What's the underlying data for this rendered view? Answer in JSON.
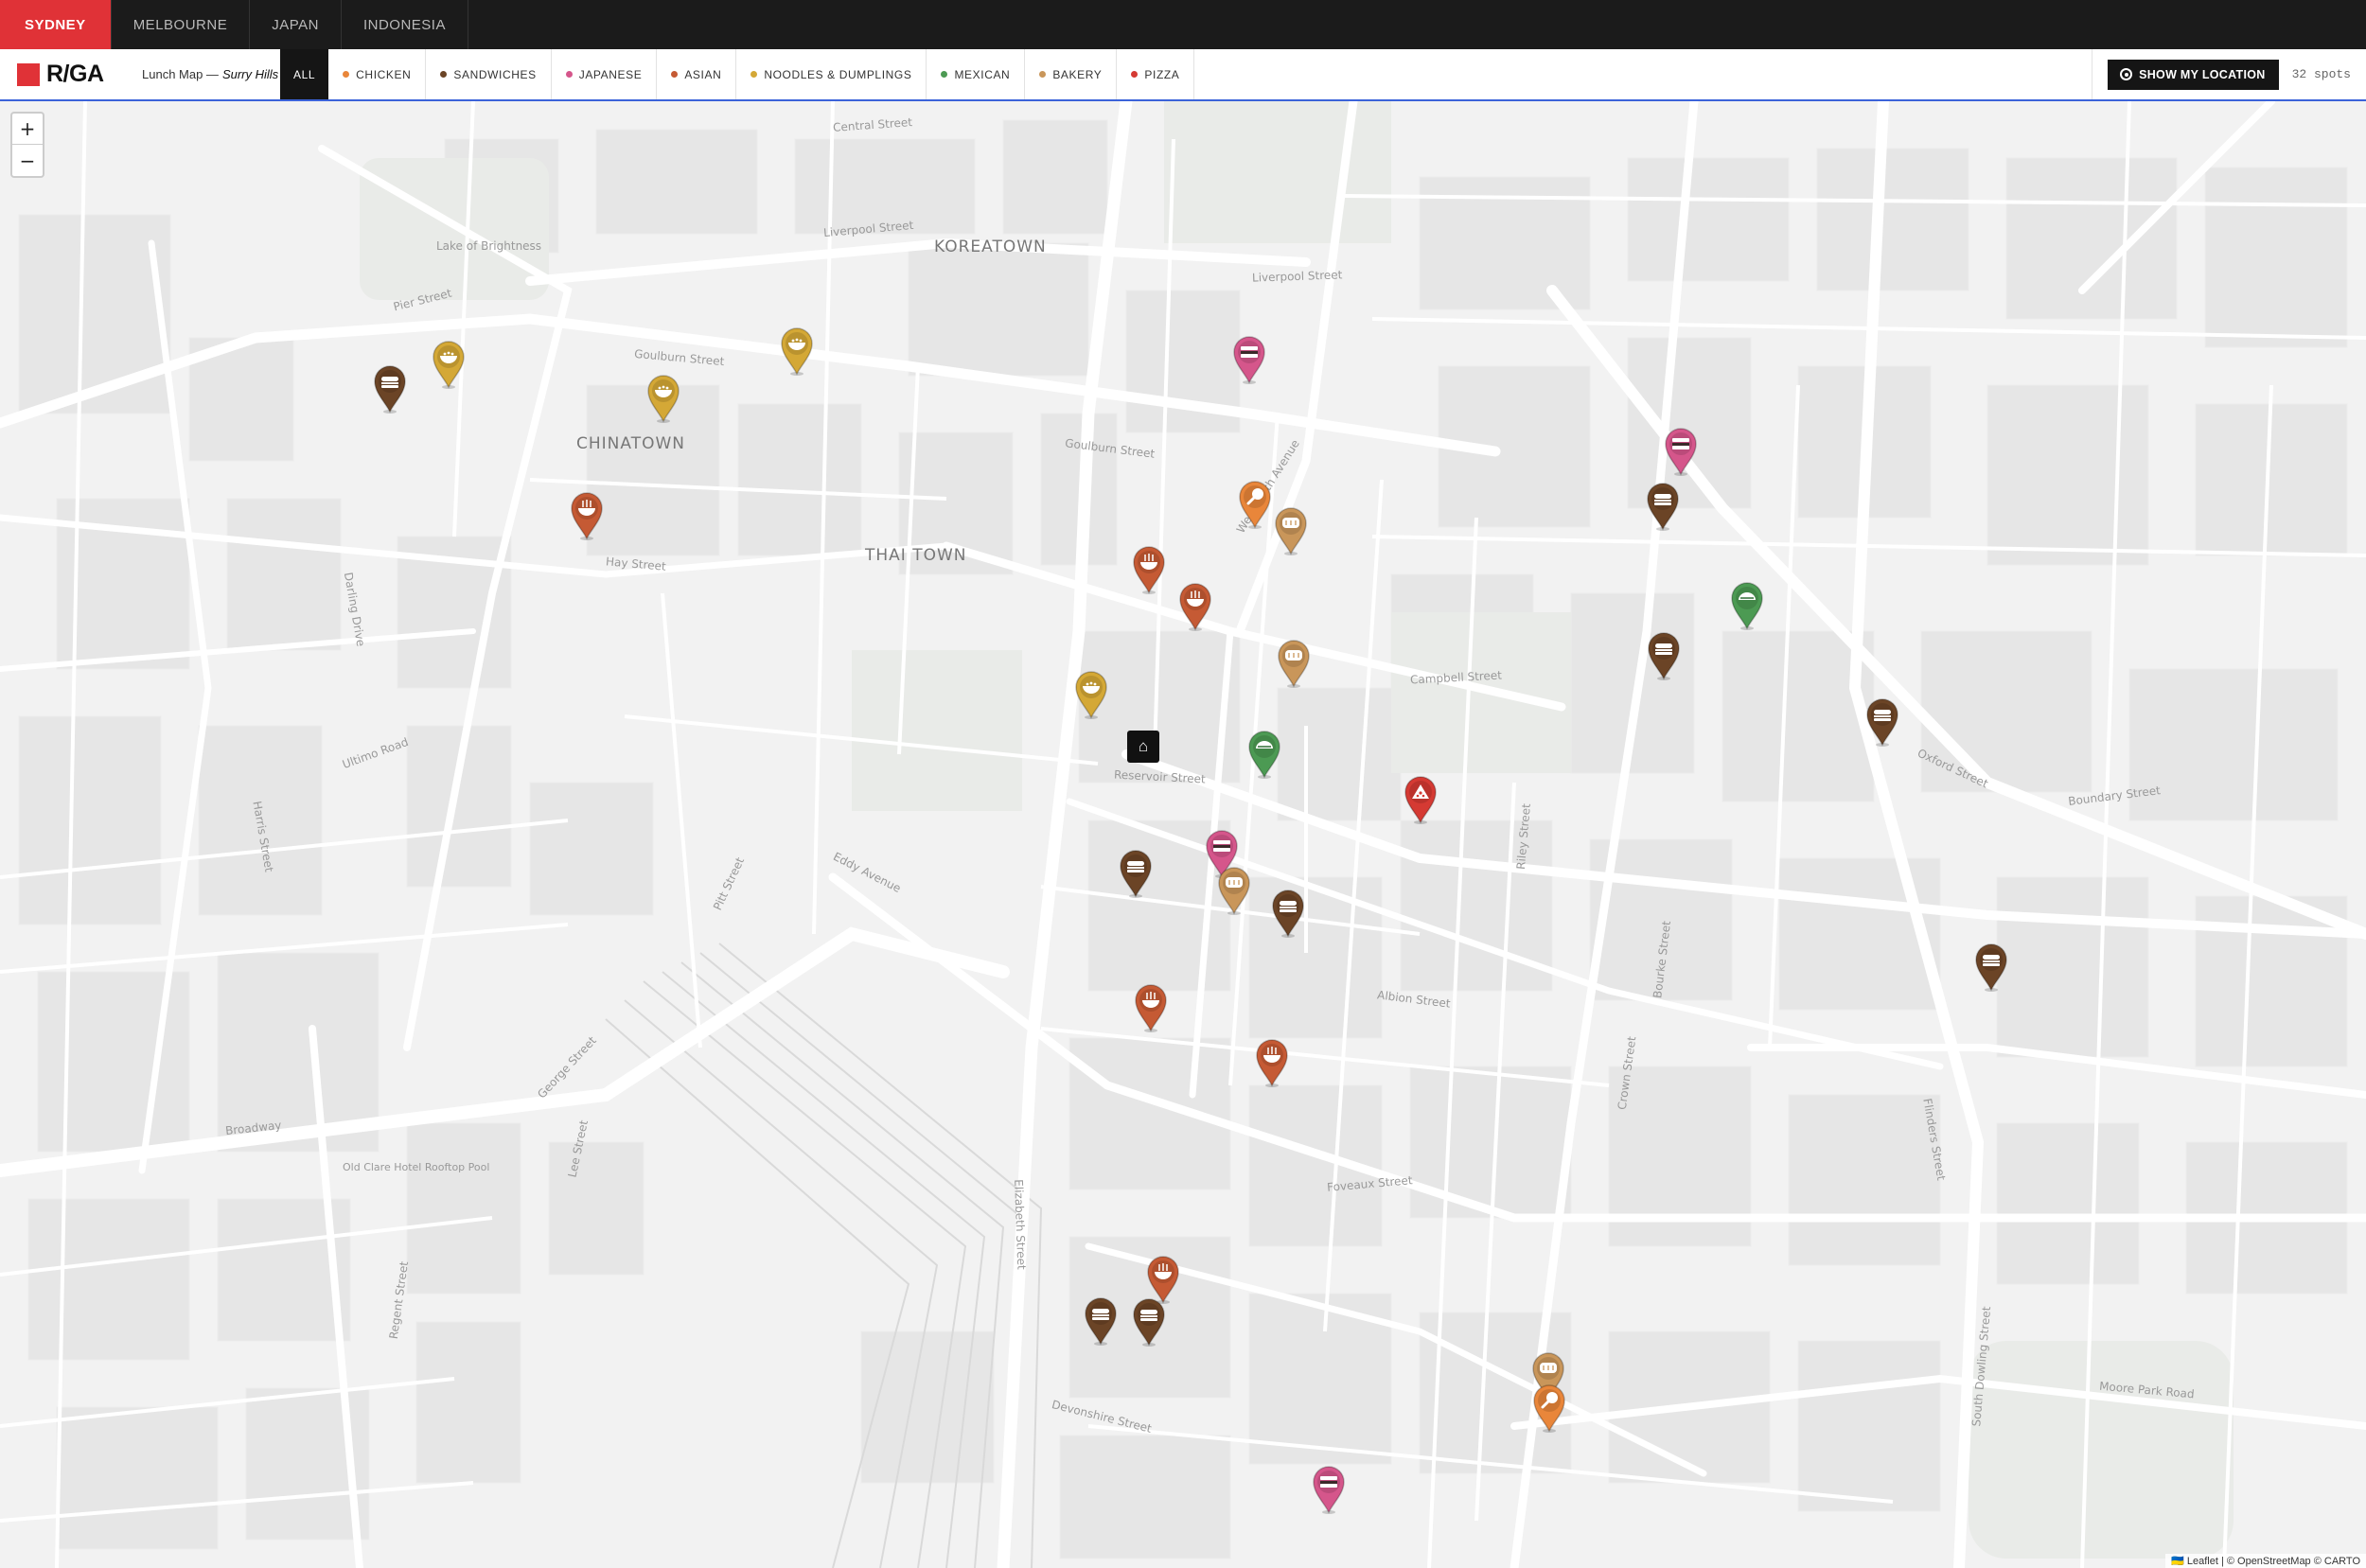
{
  "cities": [
    {
      "label": "SYDNEY",
      "active": true
    },
    {
      "label": "MELBOURNE",
      "active": false
    },
    {
      "label": "JAPAN",
      "active": false
    },
    {
      "label": "INDONESIA",
      "active": false
    }
  ],
  "brand": {
    "name": "R/GA",
    "color": "#e03237"
  },
  "map_title": {
    "prefix": "Lunch Map —",
    "location": "Surry Hills"
  },
  "categories": [
    {
      "label": "ALL",
      "active": true,
      "color": ""
    },
    {
      "label": "CHICKEN",
      "color": "#e9863a"
    },
    {
      "label": "SANDWICHES",
      "color": "#6b4426"
    },
    {
      "label": "JAPANESE",
      "color": "#d5568b"
    },
    {
      "label": "ASIAN",
      "color": "#c55a34"
    },
    {
      "label": "NOODLES & DUMPLINGS",
      "color": "#d4a836"
    },
    {
      "label": "MEXICAN",
      "color": "#4c9a53"
    },
    {
      "label": "BAKERY",
      "color": "#c9965a"
    },
    {
      "label": "PIZZA",
      "color": "#d53a33"
    }
  ],
  "show_location_label": "SHOW MY LOCATION",
  "spot_count": "32 spots",
  "zoom": {
    "in": "+",
    "out": "−"
  },
  "attribution": "🇺🇦 Leaflet | © OpenStreetMap © CARTO",
  "districts": [
    "KOREATOWN",
    "CHINATOWN",
    "THAI TOWN"
  ],
  "streets": [
    "Liverpool Street",
    "Goulburn Street",
    "Pier Street",
    "Campbell Street",
    "Albion Street",
    "Foveaux Street",
    "Oxford Street",
    "Broadway",
    "George Street",
    "Elizabeth Street",
    "Crown Street",
    "Flinders Street",
    "Eddy Avenue",
    "Devonshire Street",
    "Moore Park Road",
    "Central Street",
    "Hay Street",
    "Ultimo Road",
    "Harris Street",
    "Campbell Street",
    "Boundary Street",
    "Reservoir Street",
    "Wentworth Avenue",
    "Darling Drive",
    "Regent Street",
    "Lee Street",
    "Pitt Street",
    "Riley Street",
    "Bourke Street",
    "South Dowling Street",
    "Lake of Brightness",
    "Old Clare Hotel Rooftop Pool"
  ],
  "pins": [
    {
      "category": "SANDWICHES",
      "color": "#6b4426",
      "icon": "burger-icon"
    },
    {
      "category": "NOODLES & DUMPLINGS",
      "color": "#d4a836",
      "icon": "bowl-icon"
    },
    {
      "category": "NOODLES & DUMPLINGS",
      "color": "#d4a836",
      "icon": "bowl-icon"
    },
    {
      "category": "NOODLES & DUMPLINGS",
      "color": "#d4a836",
      "icon": "bowl-icon"
    },
    {
      "category": "ASIAN",
      "color": "#c55a34",
      "icon": "noodle-icon"
    },
    {
      "category": "JAPANESE",
      "color": "#d5568b",
      "icon": "sushi-icon"
    },
    {
      "category": "CHICKEN",
      "color": "#e9863a",
      "icon": "drumstick-icon"
    },
    {
      "category": "BAKERY",
      "color": "#c9965a",
      "icon": "bread-icon"
    },
    {
      "category": "ASIAN",
      "color": "#c55a34",
      "icon": "noodle-icon"
    },
    {
      "category": "ASIAN",
      "color": "#c55a34",
      "icon": "noodle-icon"
    },
    {
      "category": "BAKERY",
      "color": "#c9965a",
      "icon": "bread-icon"
    },
    {
      "category": "NOODLES & DUMPLINGS",
      "color": "#d4a836",
      "icon": "bowl-icon"
    },
    {
      "category": "MEXICAN",
      "color": "#4c9a53",
      "icon": "taco-icon"
    },
    {
      "category": "SANDWICHES",
      "color": "#6b4426",
      "icon": "burger-icon"
    },
    {
      "category": "JAPANESE",
      "color": "#d5568b",
      "icon": "sushi-icon"
    },
    {
      "category": "SANDWICHES",
      "color": "#6b4426",
      "icon": "burger-icon"
    },
    {
      "category": "MEXICAN",
      "color": "#4c9a53",
      "icon": "taco-icon"
    },
    {
      "category": "SANDWICHES",
      "color": "#6b4426",
      "icon": "burger-icon"
    },
    {
      "category": "PIZZA",
      "color": "#d53a33",
      "icon": "pizza-icon"
    },
    {
      "category": "SANDWICHES",
      "color": "#6b4426",
      "icon": "burger-icon"
    },
    {
      "category": "SANDWICHES",
      "color": "#6b4426",
      "icon": "burger-icon"
    },
    {
      "category": "JAPANESE",
      "color": "#d5568b",
      "icon": "sushi-icon"
    },
    {
      "category": "BAKERY",
      "color": "#c9965a",
      "icon": "bread-icon"
    },
    {
      "category": "SANDWICHES",
      "color": "#6b4426",
      "icon": "burger-icon"
    },
    {
      "category": "ASIAN",
      "color": "#c55a34",
      "icon": "noodle-icon"
    },
    {
      "category": "ASIAN",
      "color": "#c55a34",
      "icon": "noodle-icon"
    },
    {
      "category": "SANDWICHES",
      "color": "#6b4426",
      "icon": "burger-icon"
    },
    {
      "category": "ASIAN",
      "color": "#c55a34",
      "icon": "noodle-icon"
    },
    {
      "category": "SANDWICHES",
      "color": "#6b4426",
      "icon": "burger-icon"
    },
    {
      "category": "BAKERY",
      "color": "#c9965a",
      "icon": "bread-icon"
    },
    {
      "category": "CHICKEN",
      "color": "#e9863a",
      "icon": "drumstick-icon"
    },
    {
      "category": "JAPANESE",
      "color": "#d5568b",
      "icon": "sushi-icon"
    }
  ]
}
